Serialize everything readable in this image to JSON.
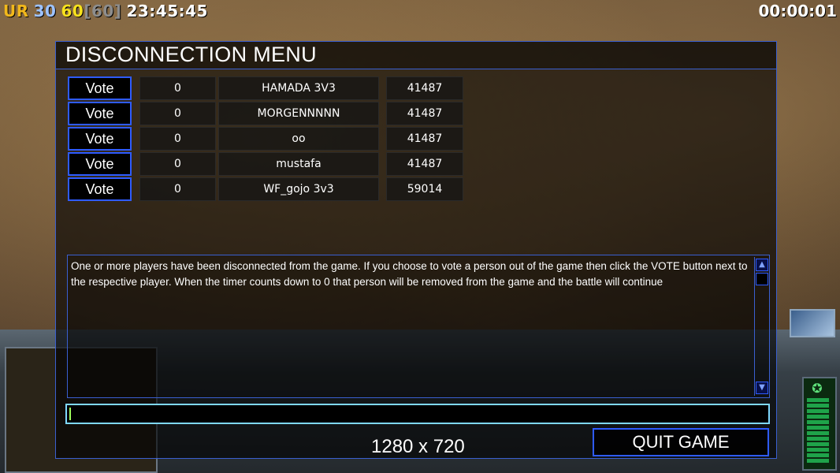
{
  "hud": {
    "rank": "UR",
    "fps_low": "30",
    "fps_cur": "60",
    "fps_cap": "[60]",
    "clock": "23:45:45",
    "timer": "00:00:01"
  },
  "dialog": {
    "title": "DISCONNECTION MENU",
    "players": [
      {
        "vote_label": "Vote",
        "count": "0",
        "name": "HAMADA 3V3",
        "ping": "41487"
      },
      {
        "vote_label": "Vote",
        "count": "0",
        "name": "MORGENNNNN",
        "ping": "41487"
      },
      {
        "vote_label": "Vote",
        "count": "0",
        "name": "oo",
        "ping": "41487"
      },
      {
        "vote_label": "Vote",
        "count": "0",
        "name": "mustafa",
        "ping": "41487"
      },
      {
        "vote_label": "Vote",
        "count": "0",
        "name": "WF_gojo 3v3",
        "ping": "59014"
      }
    ],
    "message": "One or more players have been disconnected from the game. If you choose to vote a person out of the game then click the VOTE button next to the respective player. When the timer counts down to 0 that person will be removed from the game and the battle will continue",
    "resolution": "1280 x 720",
    "quit_label": "QUIT GAME"
  },
  "colors": {
    "accent_border": "#3a5fd0",
    "button_border": "#2e5bff",
    "chat_border": "#7fd8ff"
  }
}
